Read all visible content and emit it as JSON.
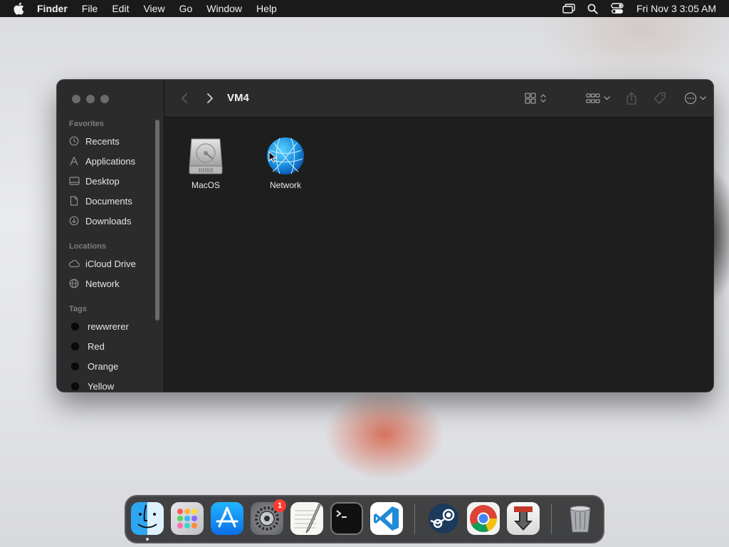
{
  "menubar": {
    "app_name": "Finder",
    "items": [
      "File",
      "Edit",
      "View",
      "Go",
      "Window",
      "Help"
    ],
    "clock": "Fri Nov 3  3:05 AM",
    "status_icons": [
      "screen-mirroring-icon",
      "spotlight-search-icon",
      "control-center-icon"
    ]
  },
  "window": {
    "title": "VM4",
    "sidebar": {
      "favorites_label": "Favorites",
      "favorites": [
        "Recents",
        "Applications",
        "Desktop",
        "Documents",
        "Downloads"
      ],
      "locations_label": "Locations",
      "locations": [
        "iCloud Drive",
        "Network"
      ],
      "tags_label": "Tags",
      "tags": [
        "rewwrerer",
        "Red",
        "Orange",
        "Yellow"
      ]
    },
    "files": [
      {
        "name": "MacOS",
        "icon": "hard-drive-icon"
      },
      {
        "name": "Network",
        "icon": "network-globe-icon"
      }
    ]
  },
  "dock": {
    "apps": [
      "Finder",
      "Launchpad",
      "App Store",
      "System Settings",
      "TextEdit",
      "Terminal",
      "Visual Studio Code",
      "Steam",
      "Google Chrome",
      "Downloader",
      "Trash"
    ],
    "system_settings_badge": "1"
  },
  "colors": {
    "menubar_bg": "#1a1a1a",
    "window_bg": "#1e1e1e",
    "sidebar_bg": "#2b2b2b",
    "badge_red": "#ff3b30"
  }
}
